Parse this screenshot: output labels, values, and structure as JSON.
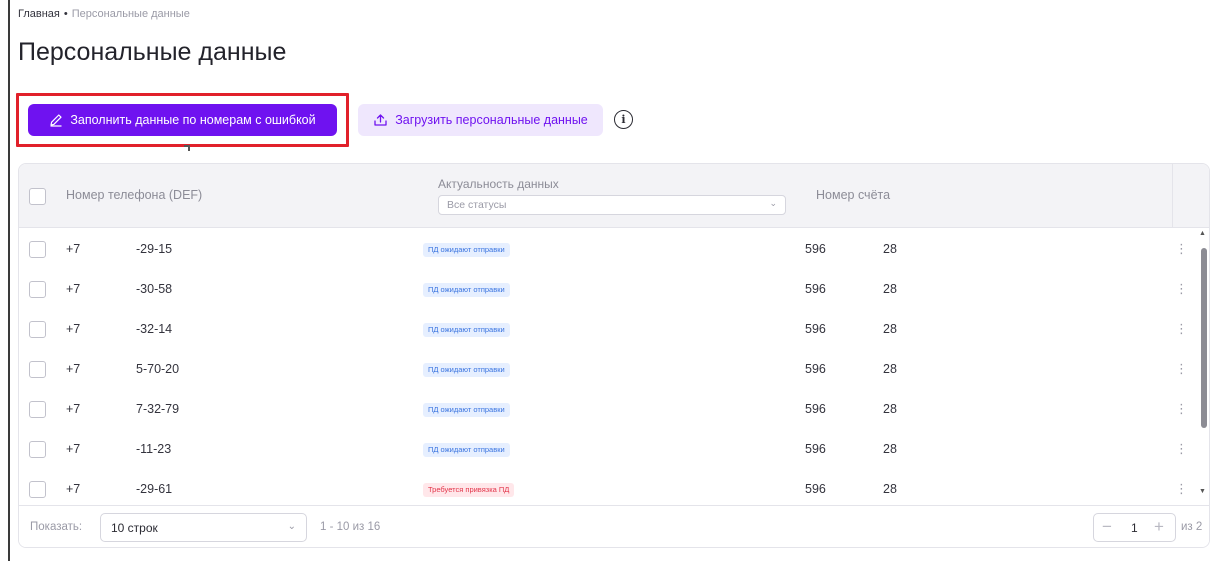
{
  "breadcrumb": {
    "home": "Главная",
    "separator": "•",
    "current": "Персональные данные"
  },
  "page": {
    "title": "Персональные данные"
  },
  "toolbar": {
    "fill_errors_label": "Заполнить данные по номерам с ошибкой",
    "upload_label": "Загрузить персональные данные",
    "info_icon": "i"
  },
  "table": {
    "columns": {
      "phone": "Номер телефона (DEF)",
      "actual": "Актуальность данных",
      "account": "Номер счёта"
    },
    "status_filter": {
      "value": "Все статусы"
    },
    "rows": [
      {
        "prefix": "+7",
        "phone": "-29-15",
        "status": "ПД ожидают отправки",
        "status_type": "blue",
        "acc1": "596",
        "acc2": "28"
      },
      {
        "prefix": "+7",
        "phone": "-30-58",
        "status": "ПД ожидают отправки",
        "status_type": "blue",
        "acc1": "596",
        "acc2": "28"
      },
      {
        "prefix": "+7",
        "phone": "-32-14",
        "status": "ПД ожидают отправки",
        "status_type": "blue",
        "acc1": "596",
        "acc2": "28"
      },
      {
        "prefix": "+7",
        "phone": "5-70-20",
        "status": "ПД ожидают отправки",
        "status_type": "blue",
        "acc1": "596",
        "acc2": "28"
      },
      {
        "prefix": "+7",
        "phone": "7-32-79",
        "status": "ПД ожидают отправки",
        "status_type": "blue",
        "acc1": "596",
        "acc2": "28"
      },
      {
        "prefix": "+7",
        "phone": "-11-23",
        "status": "ПД ожидают отправки",
        "status_type": "blue",
        "acc1": "596",
        "acc2": "28"
      },
      {
        "prefix": "+7",
        "phone": "-29-61",
        "status": "Требуется привязка ПД",
        "status_type": "red",
        "acc1": "596",
        "acc2": "28"
      }
    ]
  },
  "footer": {
    "show_label": "Показать:",
    "rows_per_page": "10 строк",
    "range": "1 - 10 из 16",
    "current_page": "1",
    "total_pages": "из 2"
  },
  "colors": {
    "primary": "#6f12f0",
    "primary_light": "#efe7fd",
    "highlight": "#e1202a",
    "badge_blue": "#3a74e0",
    "badge_red": "#e3354a"
  }
}
